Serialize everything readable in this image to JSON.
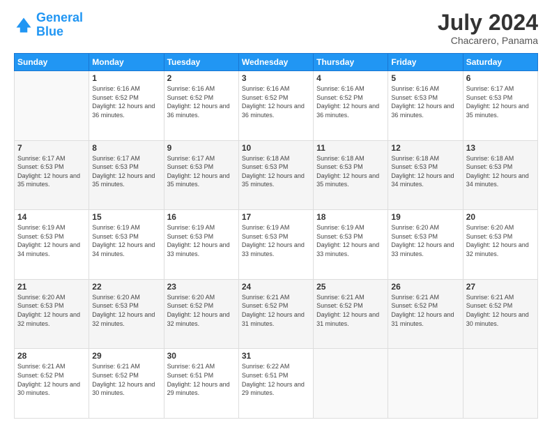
{
  "logo": {
    "line1": "General",
    "line2": "Blue"
  },
  "title": "July 2024",
  "location": "Chacarero, Panama",
  "days_header": [
    "Sunday",
    "Monday",
    "Tuesday",
    "Wednesday",
    "Thursday",
    "Friday",
    "Saturday"
  ],
  "weeks": [
    [
      {
        "day": "",
        "info": ""
      },
      {
        "day": "1",
        "info": "Sunrise: 6:16 AM\nSunset: 6:52 PM\nDaylight: 12 hours and 36 minutes."
      },
      {
        "day": "2",
        "info": "Sunrise: 6:16 AM\nSunset: 6:52 PM\nDaylight: 12 hours and 36 minutes."
      },
      {
        "day": "3",
        "info": "Sunrise: 6:16 AM\nSunset: 6:52 PM\nDaylight: 12 hours and 36 minutes."
      },
      {
        "day": "4",
        "info": "Sunrise: 6:16 AM\nSunset: 6:52 PM\nDaylight: 12 hours and 36 minutes."
      },
      {
        "day": "5",
        "info": "Sunrise: 6:16 AM\nSunset: 6:53 PM\nDaylight: 12 hours and 36 minutes."
      },
      {
        "day": "6",
        "info": "Sunrise: 6:17 AM\nSunset: 6:53 PM\nDaylight: 12 hours and 35 minutes."
      }
    ],
    [
      {
        "day": "7",
        "info": "Sunrise: 6:17 AM\nSunset: 6:53 PM\nDaylight: 12 hours and 35 minutes."
      },
      {
        "day": "8",
        "info": "Sunrise: 6:17 AM\nSunset: 6:53 PM\nDaylight: 12 hours and 35 minutes."
      },
      {
        "day": "9",
        "info": "Sunrise: 6:17 AM\nSunset: 6:53 PM\nDaylight: 12 hours and 35 minutes."
      },
      {
        "day": "10",
        "info": "Sunrise: 6:18 AM\nSunset: 6:53 PM\nDaylight: 12 hours and 35 minutes."
      },
      {
        "day": "11",
        "info": "Sunrise: 6:18 AM\nSunset: 6:53 PM\nDaylight: 12 hours and 35 minutes."
      },
      {
        "day": "12",
        "info": "Sunrise: 6:18 AM\nSunset: 6:53 PM\nDaylight: 12 hours and 34 minutes."
      },
      {
        "day": "13",
        "info": "Sunrise: 6:18 AM\nSunset: 6:53 PM\nDaylight: 12 hours and 34 minutes."
      }
    ],
    [
      {
        "day": "14",
        "info": "Sunrise: 6:19 AM\nSunset: 6:53 PM\nDaylight: 12 hours and 34 minutes."
      },
      {
        "day": "15",
        "info": "Sunrise: 6:19 AM\nSunset: 6:53 PM\nDaylight: 12 hours and 34 minutes."
      },
      {
        "day": "16",
        "info": "Sunrise: 6:19 AM\nSunset: 6:53 PM\nDaylight: 12 hours and 33 minutes."
      },
      {
        "day": "17",
        "info": "Sunrise: 6:19 AM\nSunset: 6:53 PM\nDaylight: 12 hours and 33 minutes."
      },
      {
        "day": "18",
        "info": "Sunrise: 6:19 AM\nSunset: 6:53 PM\nDaylight: 12 hours and 33 minutes."
      },
      {
        "day": "19",
        "info": "Sunrise: 6:20 AM\nSunset: 6:53 PM\nDaylight: 12 hours and 33 minutes."
      },
      {
        "day": "20",
        "info": "Sunrise: 6:20 AM\nSunset: 6:53 PM\nDaylight: 12 hours and 32 minutes."
      }
    ],
    [
      {
        "day": "21",
        "info": "Sunrise: 6:20 AM\nSunset: 6:53 PM\nDaylight: 12 hours and 32 minutes."
      },
      {
        "day": "22",
        "info": "Sunrise: 6:20 AM\nSunset: 6:53 PM\nDaylight: 12 hours and 32 minutes."
      },
      {
        "day": "23",
        "info": "Sunrise: 6:20 AM\nSunset: 6:52 PM\nDaylight: 12 hours and 32 minutes."
      },
      {
        "day": "24",
        "info": "Sunrise: 6:21 AM\nSunset: 6:52 PM\nDaylight: 12 hours and 31 minutes."
      },
      {
        "day": "25",
        "info": "Sunrise: 6:21 AM\nSunset: 6:52 PM\nDaylight: 12 hours and 31 minutes."
      },
      {
        "day": "26",
        "info": "Sunrise: 6:21 AM\nSunset: 6:52 PM\nDaylight: 12 hours and 31 minutes."
      },
      {
        "day": "27",
        "info": "Sunrise: 6:21 AM\nSunset: 6:52 PM\nDaylight: 12 hours and 30 minutes."
      }
    ],
    [
      {
        "day": "28",
        "info": "Sunrise: 6:21 AM\nSunset: 6:52 PM\nDaylight: 12 hours and 30 minutes."
      },
      {
        "day": "29",
        "info": "Sunrise: 6:21 AM\nSunset: 6:52 PM\nDaylight: 12 hours and 30 minutes."
      },
      {
        "day": "30",
        "info": "Sunrise: 6:21 AM\nSunset: 6:51 PM\nDaylight: 12 hours and 29 minutes."
      },
      {
        "day": "31",
        "info": "Sunrise: 6:22 AM\nSunset: 6:51 PM\nDaylight: 12 hours and 29 minutes."
      },
      {
        "day": "",
        "info": ""
      },
      {
        "day": "",
        "info": ""
      },
      {
        "day": "",
        "info": ""
      }
    ]
  ]
}
